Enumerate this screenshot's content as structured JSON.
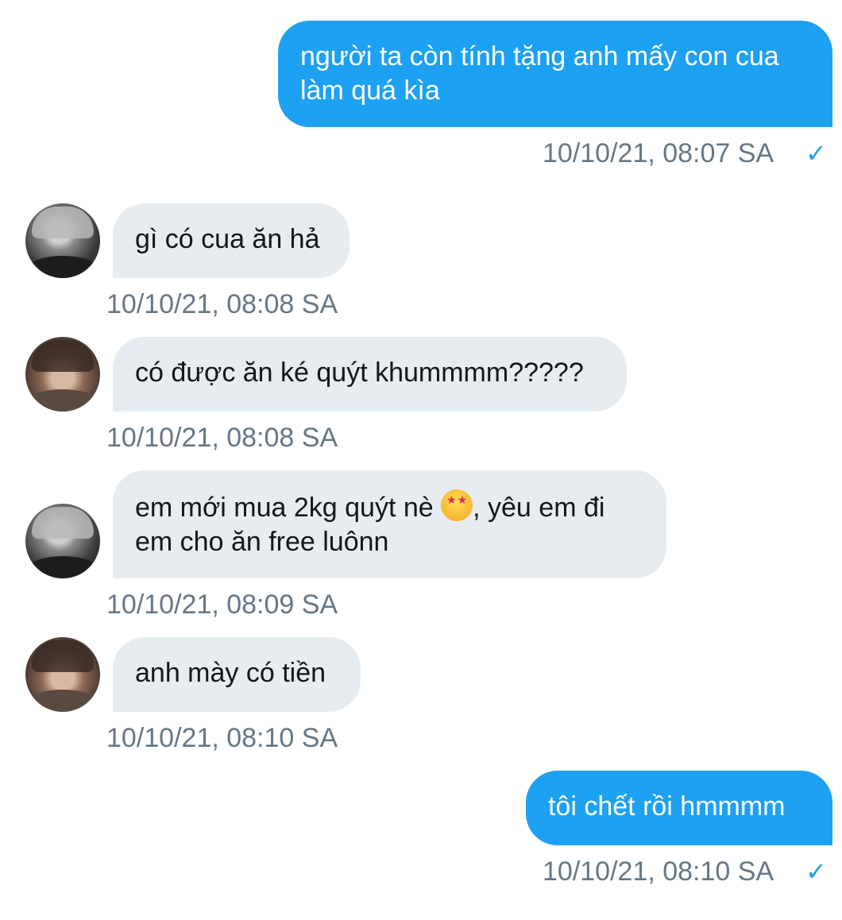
{
  "colors": {
    "outgoing_bubble": "#1da1f2",
    "incoming_bubble": "#e6ecf0",
    "timestamp": "#657786",
    "read_check": "#1da1f2"
  },
  "messages": [
    {
      "direction": "outgoing",
      "text": "người ta còn tính tặng anh mấy con cua\nlàm quá kìa",
      "time": "10/10/21, 08:07 SA",
      "status_icon": "check-icon",
      "status_glyph": "✓"
    },
    {
      "direction": "incoming",
      "avatar": "avatar-1",
      "text": "gì có cua ăn hả",
      "time": "10/10/21, 08:08 SA"
    },
    {
      "direction": "incoming",
      "avatar": "avatar-2",
      "text": "có được ăn ké quýt khummmm?????",
      "time": "10/10/21, 08:08 SA"
    },
    {
      "direction": "incoming",
      "avatar": "avatar-1",
      "text_before_emoji": "em mới mua 2kg quýt nè ",
      "emoji": "star-struck-emoji",
      "text_after_emoji": ", yêu em đi\nem cho ăn free luônn",
      "time": "10/10/21, 08:09 SA"
    },
    {
      "direction": "incoming",
      "avatar": "avatar-2",
      "text": "anh mày có tiền",
      "time": "10/10/21, 08:10 SA"
    },
    {
      "direction": "outgoing",
      "text": "tôi chết rồi hmmmm",
      "time": "10/10/21, 08:10 SA",
      "status_icon": "check-icon",
      "status_glyph": "✓"
    }
  ]
}
